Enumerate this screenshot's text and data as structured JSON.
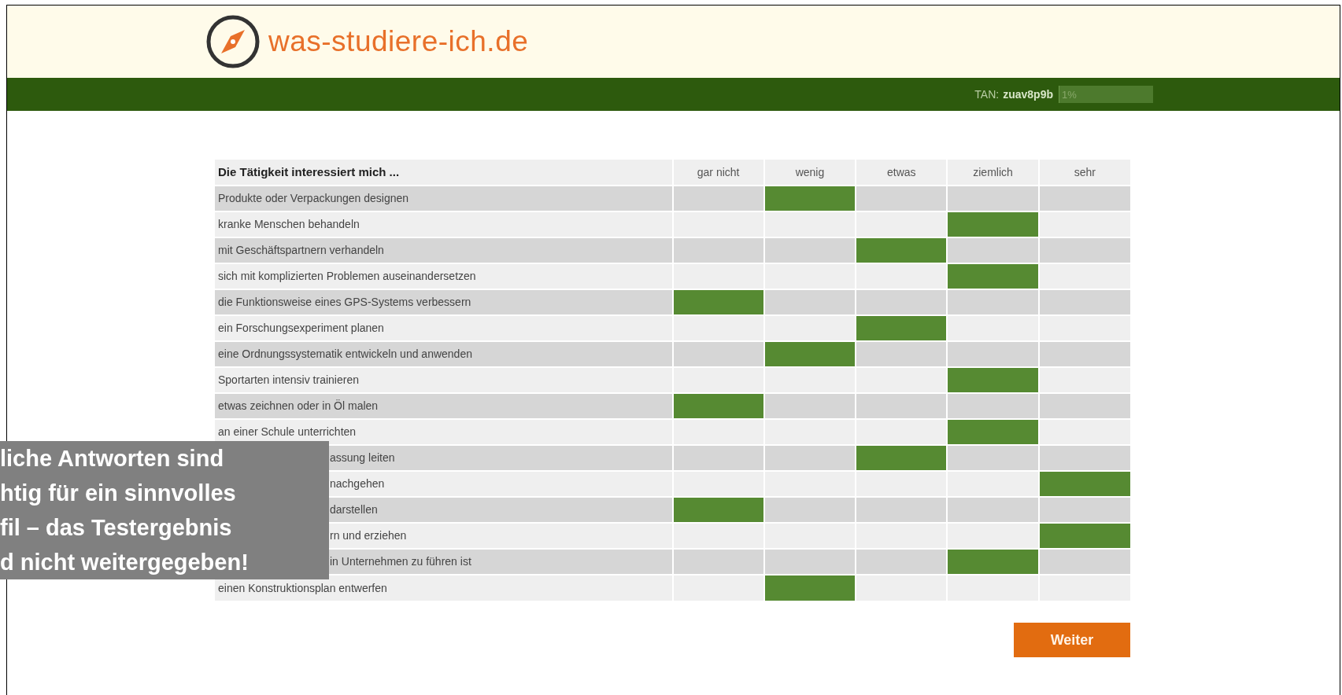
{
  "header": {
    "site_name": "was-studiere-ich.de"
  },
  "status_bar": {
    "tan_label": "TAN:",
    "tan_value": "zuav8p9b",
    "progress": {
      "text": "1%",
      "level": 0.01
    }
  },
  "table": {
    "heading": "Die Tätigkeit interessiert mich ...",
    "columns": [
      "gar nicht",
      "wenig",
      "etwas",
      "ziemlich",
      "sehr"
    ],
    "rows": [
      {
        "label": "Produkte oder Verpackungen designen",
        "cells": [
          {
            "selected": false
          },
          {
            "selected": true
          },
          {
            "selected": false
          },
          {
            "selected": false
          },
          {
            "selected": false
          }
        ]
      },
      {
        "label": "kranke Menschen behandeln",
        "cells": [
          {
            "selected": false
          },
          {
            "selected": false
          },
          {
            "selected": false
          },
          {
            "selected": true
          },
          {
            "selected": false
          }
        ]
      },
      {
        "label": "mit Geschäftspartnern verhandeln",
        "cells": [
          {
            "selected": false
          },
          {
            "selected": false
          },
          {
            "selected": true
          },
          {
            "selected": false
          },
          {
            "selected": false
          }
        ]
      },
      {
        "label": "sich mit komplizierten Problemen auseinandersetzen",
        "cells": [
          {
            "selected": false
          },
          {
            "selected": false
          },
          {
            "selected": false
          },
          {
            "selected": true
          },
          {
            "selected": false
          }
        ]
      },
      {
        "label": "die Funktionsweise eines GPS-Systems verbessern",
        "cells": [
          {
            "selected": true
          },
          {
            "selected": false
          },
          {
            "selected": false
          },
          {
            "selected": false
          },
          {
            "selected": false
          }
        ]
      },
      {
        "label": "ein Forschungsexperiment planen",
        "cells": [
          {
            "selected": false
          },
          {
            "selected": false
          },
          {
            "selected": true
          },
          {
            "selected": false
          },
          {
            "selected": false
          }
        ]
      },
      {
        "label": "eine Ordnungssystematik entwickeln und anwenden",
        "cells": [
          {
            "selected": false
          },
          {
            "selected": true
          },
          {
            "selected": false
          },
          {
            "selected": false
          },
          {
            "selected": false
          }
        ]
      },
      {
        "label": "Sportarten intensiv trainieren",
        "cells": [
          {
            "selected": false
          },
          {
            "selected": false
          },
          {
            "selected": false
          },
          {
            "selected": true
          },
          {
            "selected": false
          }
        ]
      },
      {
        "label": "etwas zeichnen oder in Öl malen",
        "cells": [
          {
            "selected": true
          },
          {
            "selected": false
          },
          {
            "selected": false
          },
          {
            "selected": false
          },
          {
            "selected": false
          }
        ]
      },
      {
        "label": "an einer Schule unterrichten",
        "cells": [
          {
            "selected": false
          },
          {
            "selected": false
          },
          {
            "selected": false
          },
          {
            "selected": true
          },
          {
            "selected": false
          }
        ]
      },
      {
        "label": "assung leiten",
        "covered": true,
        "cells": [
          {
            "selected": false
          },
          {
            "selected": false
          },
          {
            "selected": true
          },
          {
            "selected": false
          },
          {
            "selected": false
          }
        ]
      },
      {
        "label": "nachgehen",
        "covered": true,
        "cells": [
          {
            "selected": false
          },
          {
            "selected": false
          },
          {
            "selected": false
          },
          {
            "selected": false
          },
          {
            "selected": true
          }
        ]
      },
      {
        "label": "darstellen",
        "covered": true,
        "cells": [
          {
            "selected": true
          },
          {
            "selected": false
          },
          {
            "selected": false
          },
          {
            "selected": false
          },
          {
            "selected": false
          }
        ]
      },
      {
        "label": "rn und erziehen",
        "covered": true,
        "cells": [
          {
            "selected": false
          },
          {
            "selected": false
          },
          {
            "selected": false
          },
          {
            "selected": false
          },
          {
            "selected": true
          }
        ]
      },
      {
        "label": "in Unternehmen zu führen ist",
        "covered": true,
        "cells": [
          {
            "selected": false
          },
          {
            "selected": false
          },
          {
            "selected": false
          },
          {
            "selected": true
          },
          {
            "selected": false
          }
        ]
      },
      {
        "label": "einen Konstruktionsplan entwerfen",
        "cells": [
          {
            "selected": false
          },
          {
            "selected": true
          },
          {
            "selected": false
          },
          {
            "selected": false
          },
          {
            "selected": false
          }
        ]
      }
    ]
  },
  "buttons": [
    "Weiter"
  ],
  "overlay": {
    "lines": [
      "liche Antworten sind",
      "htig für ein sinnvolles",
      "fil – das Testergebnis",
      "d nicht weitergegeben!"
    ]
  }
}
